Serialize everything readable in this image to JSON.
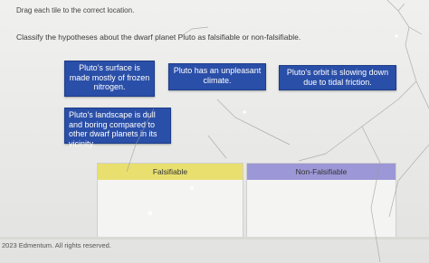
{
  "instruction": "Drag each tile to the correct location.",
  "question": "Classify the hypotheses about the dwarf planet Pluto as falsifiable or non-falsifiable.",
  "tiles": [
    {
      "text": "Pluto's surface is made mostly of frozen nitrogen."
    },
    {
      "text": "Pluto has an unpleasant climate."
    },
    {
      "text": "Pluto's orbit is slowing down due to tidal friction."
    },
    {
      "text": "Pluto's landscape is dull and boring compared to other dwarf planets in its vicinity."
    }
  ],
  "columns": {
    "falsifiable": {
      "label": "Falsifiable",
      "color": "#e8df6f"
    },
    "non_falsifiable": {
      "label": "Non-Falsifiable",
      "color": "#9c97d6"
    }
  },
  "tile_color": "#2a4fa8",
  "footer": "2023 Edmentum. All rights reserved."
}
